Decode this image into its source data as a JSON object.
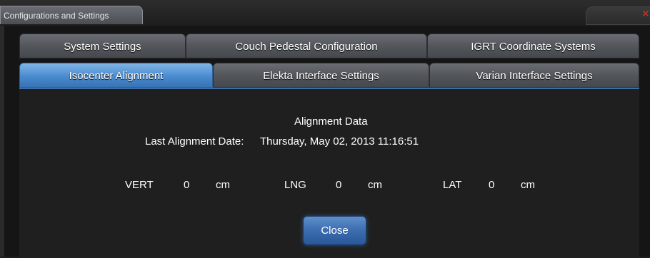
{
  "window": {
    "title": "Configurations and Settings",
    "close_glyph": "✕"
  },
  "tabs": {
    "row1": [
      {
        "label": "System Settings",
        "active": false
      },
      {
        "label": "Couch Pedestal Configuration",
        "active": false
      },
      {
        "label": "IGRT Coordinate Systems",
        "active": false
      }
    ],
    "row2": [
      {
        "label": "Isocenter Alignment",
        "active": true
      },
      {
        "label": "Elekta Interface Settings",
        "active": false
      },
      {
        "label": "Varian Interface Settings",
        "active": false
      }
    ]
  },
  "alignment": {
    "heading": "Alignment Data",
    "last_date_label": "Last Alignment Date:",
    "last_date_value": "Thursday, May 02, 2013 11:16:51",
    "vert_label": "VERT",
    "vert_value": "0",
    "vert_unit": "cm",
    "lng_label": "LNG",
    "lng_value": "0",
    "lng_unit": "cm",
    "lat_label": "LAT",
    "lat_value": "0",
    "lat_unit": "cm"
  },
  "buttons": {
    "close_label": "Close"
  },
  "colors": {
    "active_tab": "#4a8bd0",
    "inactive_tab": "#53565b",
    "close_x": "#c0392b"
  },
  "icons": {
    "window_close": "close-icon"
  }
}
